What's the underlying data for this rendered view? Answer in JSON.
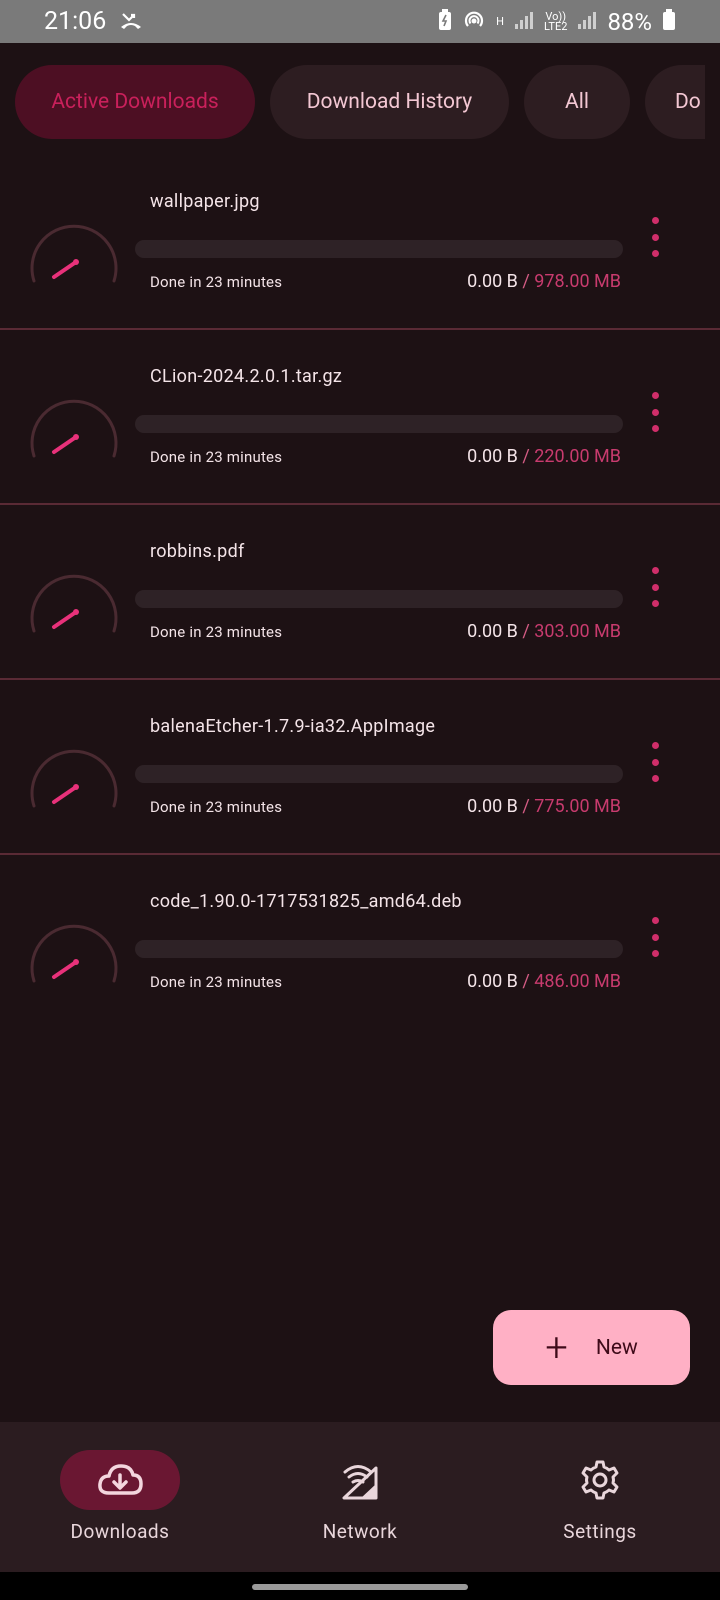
{
  "status_bar": {
    "time": "21:06",
    "battery": "88%",
    "network_h": "H",
    "volte": "Vo))",
    "lte": "LTE2"
  },
  "tabs": [
    {
      "label": "Active Downloads",
      "active": true
    },
    {
      "label": "Download History",
      "active": false
    },
    {
      "label": "All",
      "active": false
    },
    {
      "label": "Do",
      "active": false
    }
  ],
  "downloads": [
    {
      "name": "wallpaper.jpg",
      "eta": "Done in 23 minutes",
      "downloaded": "0.00 B",
      "separator": "/",
      "total": "978.00 MB",
      "progress": 0
    },
    {
      "name": "CLion-2024.2.0.1.tar.gz",
      "eta": "Done in 23 minutes",
      "downloaded": "0.00 B",
      "separator": "/",
      "total": "220.00 MB",
      "progress": 0
    },
    {
      "name": "robbins.pdf",
      "eta": "Done in 23 minutes",
      "downloaded": "0.00 B",
      "separator": "/",
      "total": "303.00 MB",
      "progress": 0
    },
    {
      "name": "balenaEtcher-1.7.9-ia32.AppImage",
      "eta": "Done in 23 minutes",
      "downloaded": "0.00 B",
      "separator": "/",
      "total": "775.00 MB",
      "progress": 0
    },
    {
      "name": "code_1.90.0-1717531825_amd64.deb",
      "eta": "Done in 23 minutes",
      "downloaded": "0.00 B",
      "separator": "/",
      "total": "486.00 MB",
      "progress": 0
    }
  ],
  "fab": {
    "label": "New",
    "icon": "plus-icon"
  },
  "bottom_nav": [
    {
      "label": "Downloads",
      "icon": "cloud-download-icon",
      "active": true
    },
    {
      "label": "Network",
      "icon": "network-signal-icon",
      "active": false
    },
    {
      "label": "Settings",
      "icon": "gear-icon",
      "active": false
    }
  ],
  "colors": {
    "background": "#1d1114",
    "accent": "#d02e6a",
    "fab": "#ffb0c5",
    "active_chip": "#4d0f23"
  }
}
